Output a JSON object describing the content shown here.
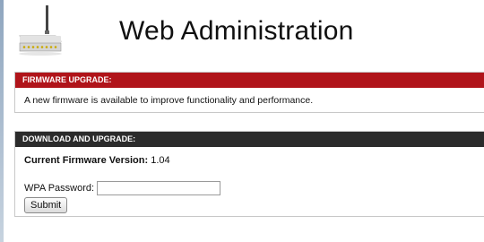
{
  "header": {
    "title": "Web Administration",
    "logo_icon": "router-icon"
  },
  "firmware_panel": {
    "heading": "FIRMWARE UPGRADE:",
    "message": "A new firmware is available to improve functionality and performance.",
    "accent_color": "#b0141a"
  },
  "download_panel": {
    "heading": "DOWNLOAD AND UPGRADE:",
    "version_label": "Current Firmware Version:",
    "version_value": "1.04",
    "password_label": "WPA Password:",
    "password_value": "",
    "submit_label": "Submit",
    "header_color": "#2b2b2b"
  }
}
